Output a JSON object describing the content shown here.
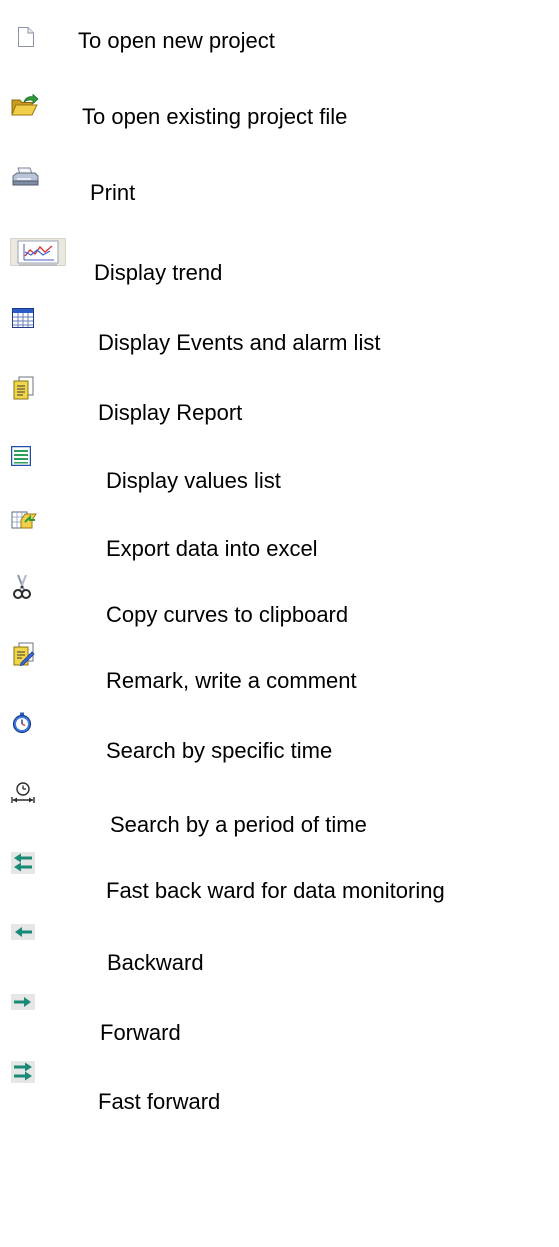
{
  "toolbar_legend": {
    "items": [
      {
        "icon": "new-document-icon",
        "label": "To open new project"
      },
      {
        "icon": "open-folder-icon",
        "label": "To open existing project file"
      },
      {
        "icon": "printer-icon",
        "label": "Print"
      },
      {
        "icon": "trend-chart-icon",
        "label": "Display trend"
      },
      {
        "icon": "event-list-icon",
        "label": "Display Events and alarm list"
      },
      {
        "icon": "report-icon",
        "label": "Display Report"
      },
      {
        "icon": "values-list-icon",
        "label": "Display values list"
      },
      {
        "icon": "export-excel-icon",
        "label": "Export data into excel"
      },
      {
        "icon": "scissors-icon",
        "label": "Copy curves to clipboard"
      },
      {
        "icon": "remark-icon",
        "label": "Remark, write a comment"
      },
      {
        "icon": "stopwatch-icon",
        "label": "Search by specific time"
      },
      {
        "icon": "time-period-icon",
        "label": "Search by a period of time"
      },
      {
        "icon": "fast-backward-icon",
        "label": "Fast back ward for data monitoring"
      },
      {
        "icon": "backward-icon",
        "label": "Backward"
      },
      {
        "icon": "forward-icon",
        "label": "Forward"
      },
      {
        "icon": "fast-forward-icon",
        "label": "Fast forward"
      }
    ]
  },
  "colors": {
    "arrow_teal": "#1a8a78",
    "folder_yellow": "#e8c23a",
    "list_green": "#2aa05a",
    "list_blue": "#1f4fa8"
  }
}
